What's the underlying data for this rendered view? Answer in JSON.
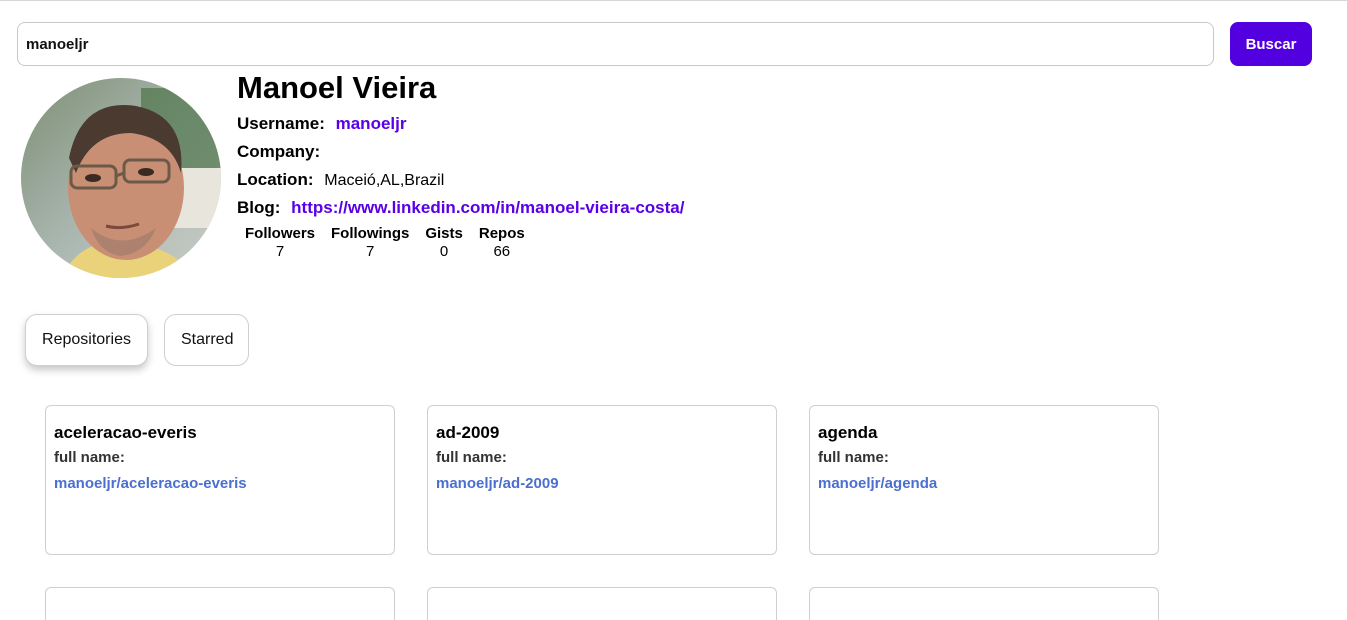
{
  "search": {
    "value": "manoeljr",
    "button_label": "Buscar"
  },
  "profile": {
    "name": "Manoel Vieira",
    "username_label": "Username:",
    "username": "manoeljr",
    "company_label": "Company:",
    "company": "",
    "location_label": "Location:",
    "location": "Maceió,AL,Brazil",
    "blog_label": "Blog:",
    "blog": "https://www.linkedin.com/in/manoel-vieira-costa/",
    "stats": [
      {
        "label": "Followers",
        "value": "7"
      },
      {
        "label": "Followings",
        "value": "7"
      },
      {
        "label": "Gists",
        "value": "0"
      },
      {
        "label": "Repos",
        "value": "66"
      }
    ]
  },
  "tabs": [
    {
      "label": "Repositories",
      "active": true
    },
    {
      "label": "Starred",
      "active": false
    }
  ],
  "repos": [
    {
      "name": "aceleracao-everis",
      "full_name_label": "full name:",
      "full_name": "manoeljr/aceleracao-everis"
    },
    {
      "name": "ad-2009",
      "full_name_label": "full name:",
      "full_name": "manoeljr/ad-2009"
    },
    {
      "name": "agenda",
      "full_name_label": "full name:",
      "full_name": "manoeljr/agenda"
    }
  ],
  "colors": {
    "accent": "#5200e0",
    "link": "#5a00e6",
    "repo_link": "#4a6fcf"
  }
}
